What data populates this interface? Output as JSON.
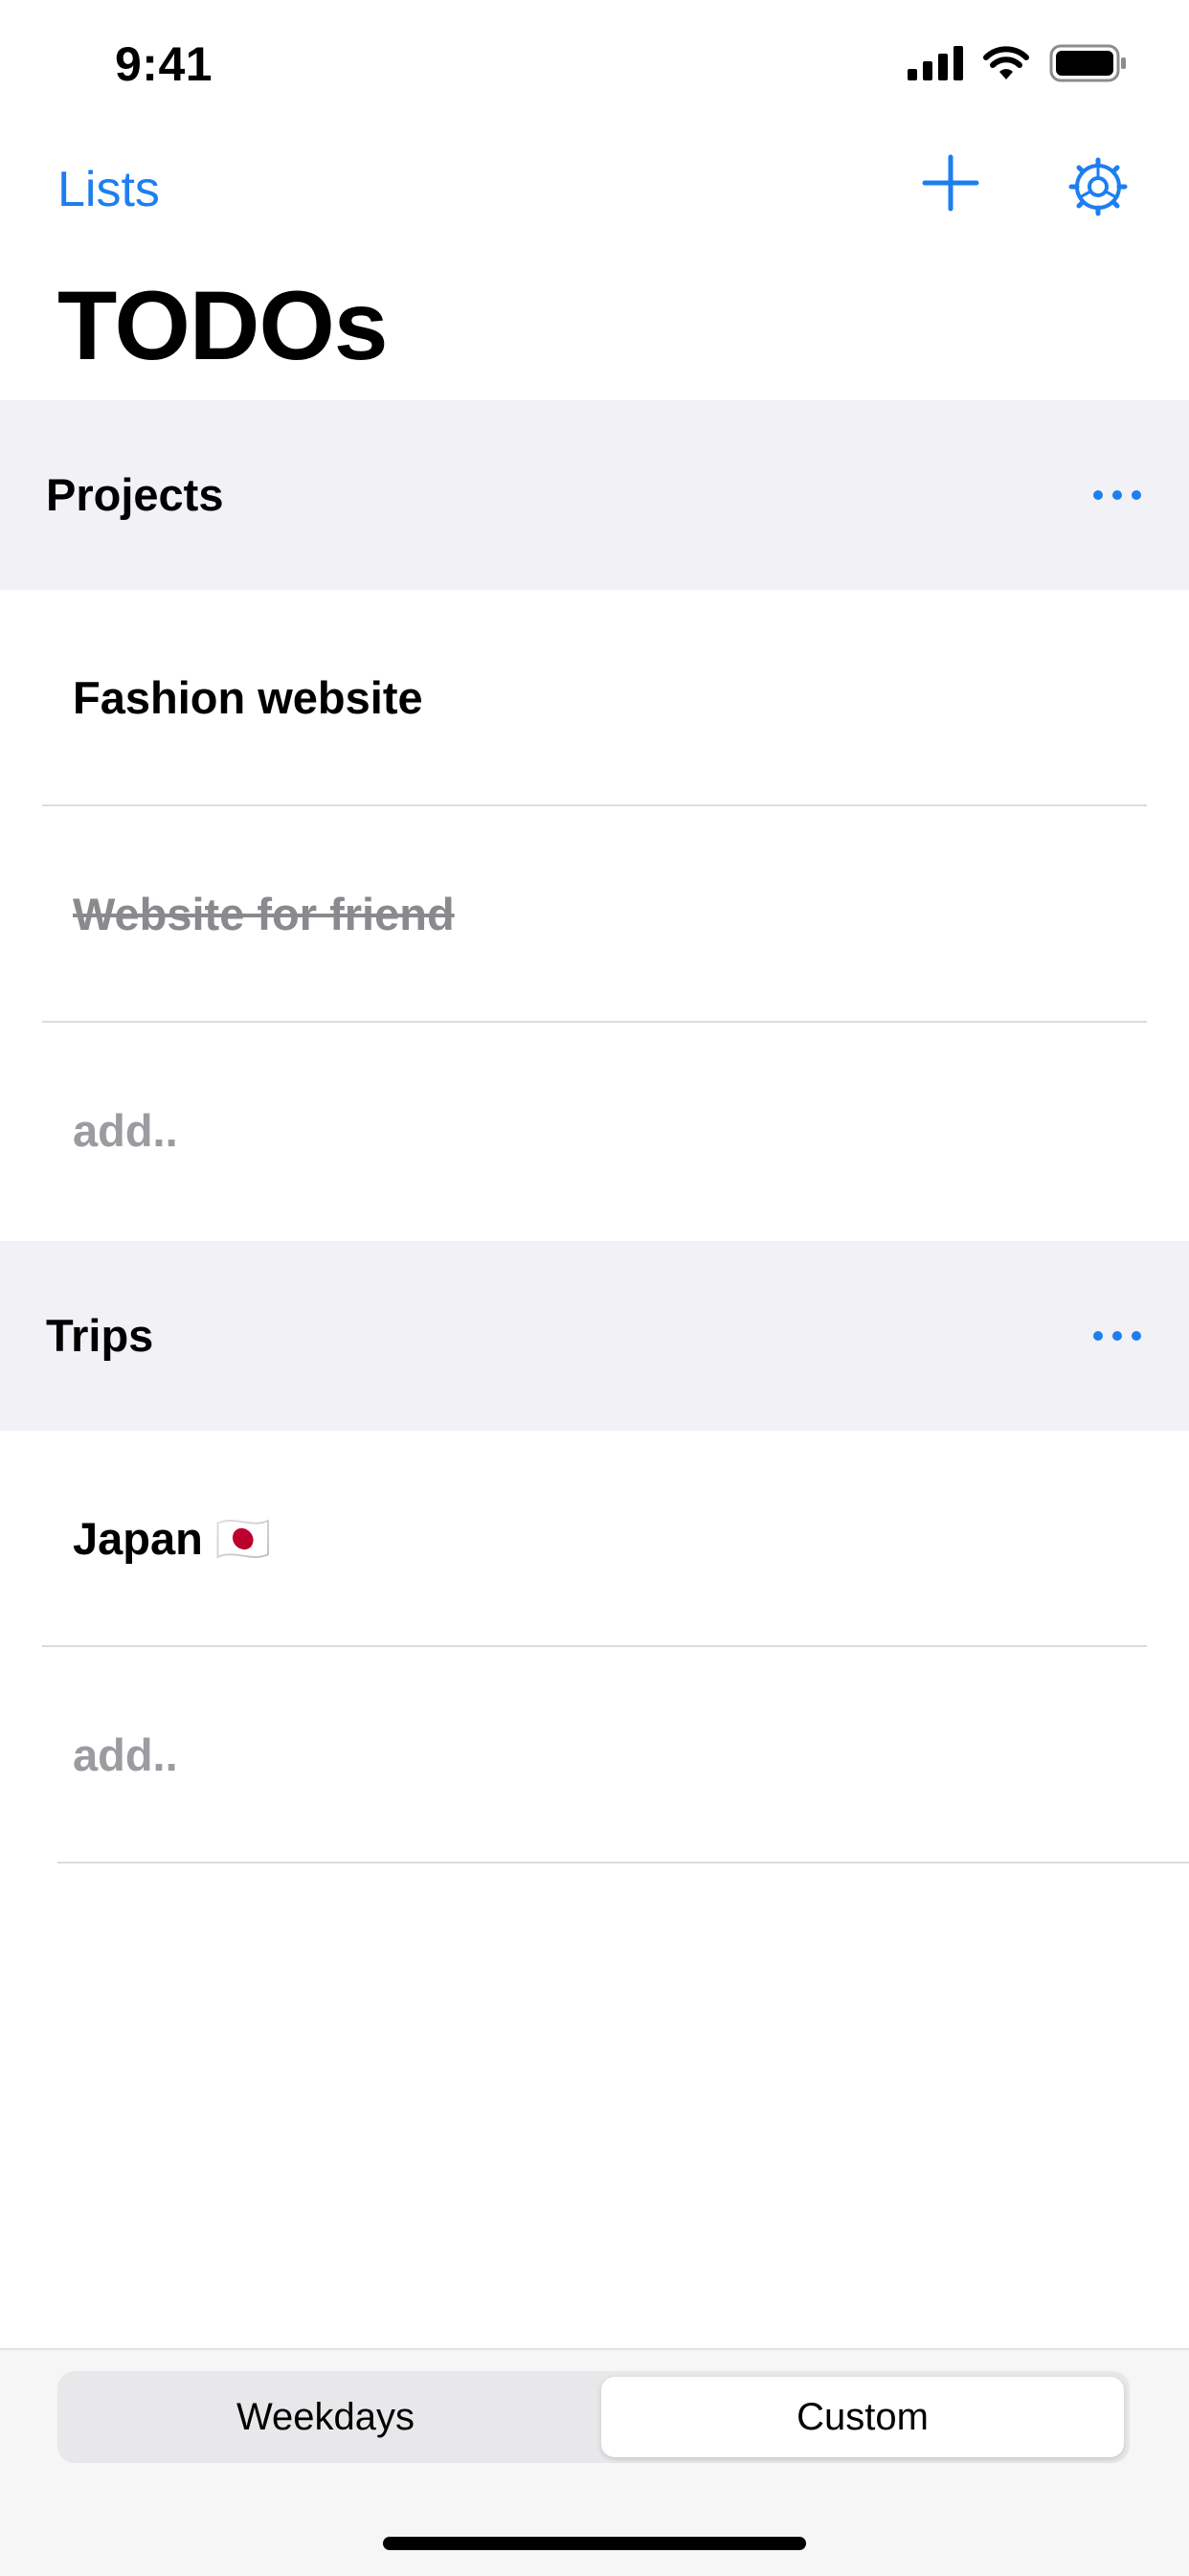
{
  "status": {
    "time": "9:41"
  },
  "nav": {
    "back_label": "Lists",
    "title": "TODOs"
  },
  "sections": [
    {
      "title": "Projects",
      "items": [
        {
          "text": "Fashion website",
          "done": false
        },
        {
          "text": "Website for friend",
          "done": true
        }
      ],
      "add_placeholder": "add.."
    },
    {
      "title": "Trips",
      "items": [
        {
          "text": "Japan 🇯🇵",
          "done": false
        }
      ],
      "add_placeholder": "add.."
    }
  ],
  "segmented": {
    "options": [
      "Weekdays",
      "Custom"
    ],
    "selected": "Custom"
  },
  "colors": {
    "accent": "#1d7ef0",
    "section_bg": "#f1f1f6",
    "muted": "#8a8a8e"
  }
}
